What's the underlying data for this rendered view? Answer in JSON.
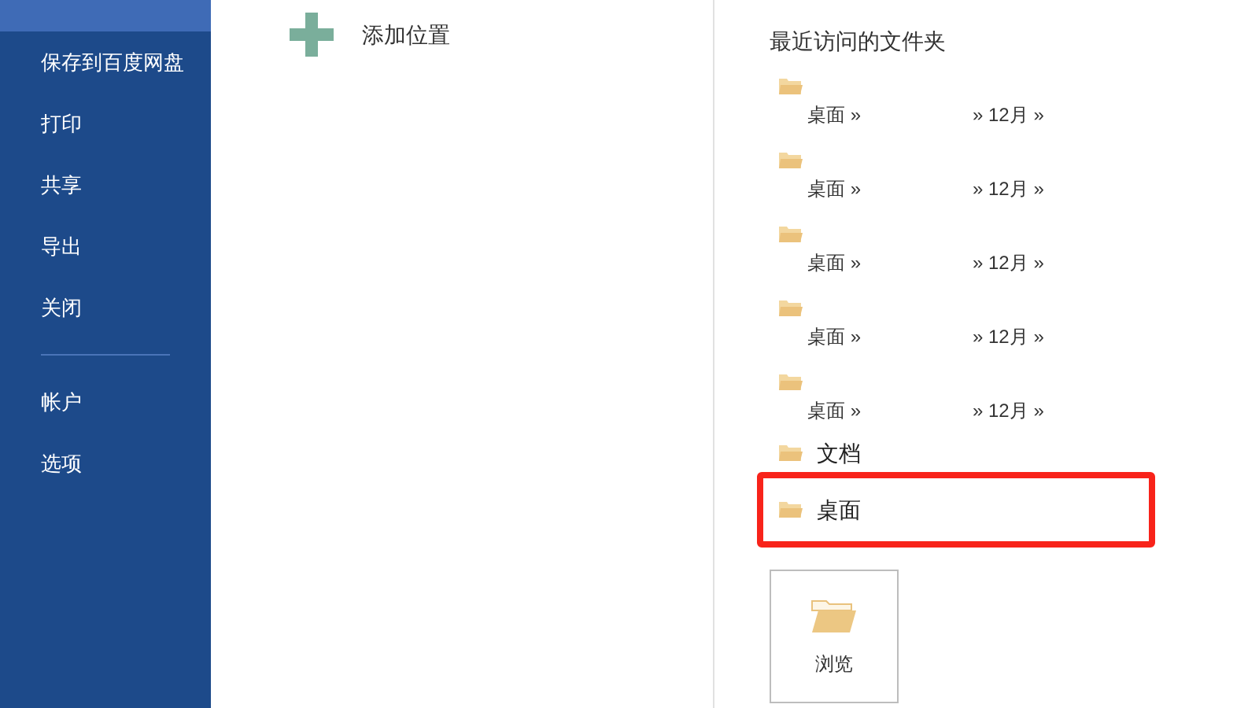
{
  "sidebar": {
    "items": [
      {
        "selected": true,
        "kind": "item"
      },
      {
        "label": "保存到百度网盘",
        "selected": false,
        "kind": "item"
      },
      {
        "label": "打印",
        "selected": false,
        "kind": "item"
      },
      {
        "label": "共享",
        "selected": false,
        "kind": "item"
      },
      {
        "label": "导出",
        "selected": false,
        "kind": "item"
      },
      {
        "label": "关闭",
        "selected": false,
        "kind": "item"
      },
      {
        "kind": "divider"
      },
      {
        "label": "帐户",
        "selected": false,
        "kind": "item"
      },
      {
        "label": "选项",
        "selected": false,
        "kind": "item"
      }
    ]
  },
  "add_location": {
    "label": "添加位置"
  },
  "recent": {
    "title": "最近访问的文件夹",
    "folders": [
      {
        "kind": "path",
        "path_start": "桌面 »",
        "path_end": "» 12月 »",
        "highlighted": false
      },
      {
        "kind": "path",
        "path_start": "桌面 »",
        "path_end": "» 12月 »",
        "highlighted": false
      },
      {
        "kind": "path",
        "path_start": "桌面 »",
        "path_end": "» 12月 »",
        "highlighted": false
      },
      {
        "kind": "path",
        "path_start": "桌面 »",
        "path_end": "» 12月 »",
        "highlighted": false
      },
      {
        "kind": "path",
        "path_start": "桌面 »",
        "path_end": "» 12月 »",
        "highlighted": false
      },
      {
        "kind": "named",
        "name": "文档",
        "highlighted": false
      },
      {
        "kind": "named",
        "name": "桌面",
        "highlighted": true
      }
    ]
  },
  "browse": {
    "label": "浏览"
  }
}
